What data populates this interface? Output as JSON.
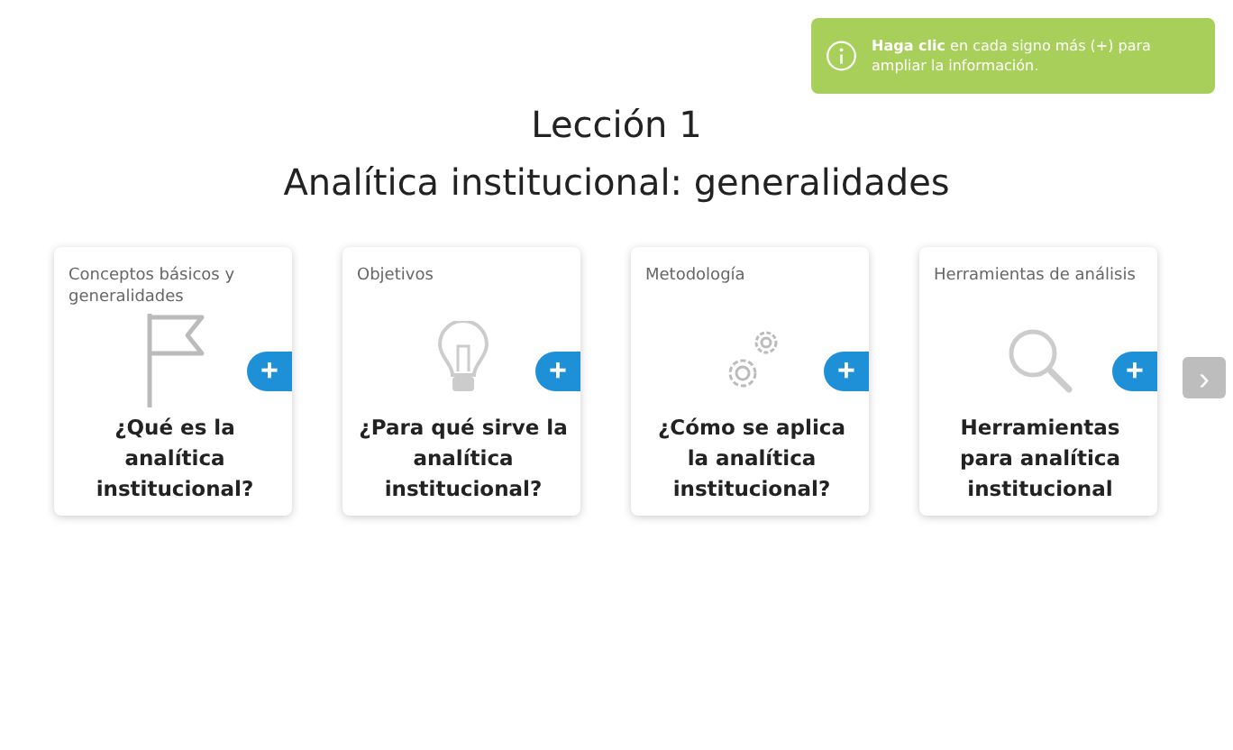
{
  "notice": {
    "text": "**Haga clic** en cada signo más (+) para ampliar la información."
  },
  "title": {
    "lesson": "Lección 1",
    "subtitle": "Analítica institucional: generalidades"
  },
  "cards": [
    {
      "category": "Conceptos básicos y generalidades",
      "question": "¿Qué es la analítica institucional?",
      "button": "+"
    },
    {
      "category": "Objetivos",
      "question": "¿Para qué sirve la analítica institucional?",
      "button": "+"
    },
    {
      "category": "Metodología",
      "question": "¿Cómo se aplica la analítica institucional?",
      "button": "+"
    },
    {
      "category": "Herramientas de análisis",
      "question": "Herramientas para analítica institucional",
      "button": "+"
    }
  ],
  "next_button": "›"
}
